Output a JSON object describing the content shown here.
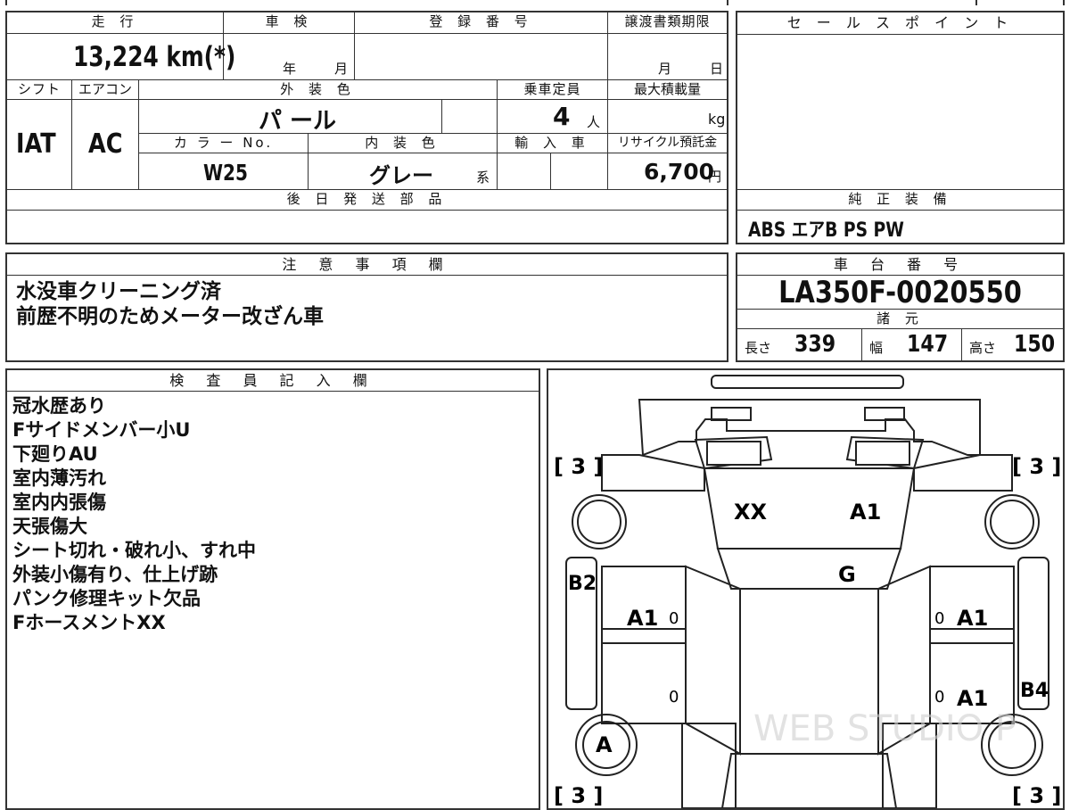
{
  "top_table": {
    "mileage_header": "走 行",
    "mileage": "13,224 km(*)",
    "shaken_header": "車 検",
    "shaken_year_unit": "年",
    "shaken_month_unit": "月",
    "registration_header": "登 録 番 号",
    "transfer_header": "譲渡書類期限",
    "transfer_month_unit": "月",
    "transfer_day_unit": "日",
    "shift_header": "シフト",
    "aircon_header": "エアコン",
    "exterior_header": "外 装 色",
    "capacity_header": "乗車定員",
    "maxload_header": "最大積載量",
    "shift": "IAT",
    "aircon": "AC",
    "exterior_color": "パ ール",
    "capacity": "4",
    "capacity_unit": "人",
    "maxload_unit": "kg",
    "color_no_header": "カ ラ ー No.",
    "interior_header": "内 装 色",
    "import_header": "輸 入 車",
    "recycle_header": "リサイクル預託金",
    "color_no": "W25",
    "interior_color": "グレー",
    "interior_suffix": "系",
    "recycle_fee": "6,700",
    "recycle_unit": "円",
    "later_parts_header": "後 日 発 送 部 品"
  },
  "sales_point": {
    "header": "セ ー ル ス ポ イ ン ト"
  },
  "equipment": {
    "header": "純 正 装 備",
    "value": "ABS エアB PS PW"
  },
  "notes": {
    "header": "注 意 事 項 欄",
    "lines": [
      "水没車クリーニング済",
      "前歴不明のためメーター改ざん車"
    ]
  },
  "chassis": {
    "header": "車 台 番 号",
    "number": "LA350F-0020550",
    "specs_header": "諸 元",
    "length_label": "長さ",
    "length": "339",
    "width_label": "幅",
    "width": "147",
    "height_label": "高さ",
    "height": "150"
  },
  "inspector": {
    "header": "検 査 員 記 入 欄",
    "lines": [
      "冠水歴あり",
      "Fサイドメンバー小U",
      "下廻りAU",
      "室内薄汚れ",
      "室内内張傷",
      "天張傷大",
      "シート切れ・破れ小、すれ中",
      "外装小傷有り、仕上げ跡",
      "パンク修理キット欠品",
      "FホースメントXX"
    ]
  },
  "diagram": {
    "tire_marks": [
      "[ 3 ]",
      "[ 3 ]",
      "[ 3 ]",
      "[ 3 ]"
    ],
    "marks": {
      "windshield_left": "XX",
      "windshield_right": "A1",
      "roof": "G",
      "left_side": "B2",
      "front_door_left": "A1",
      "front_door_right": "A1",
      "rear_door_right": "A1",
      "right_side": "B4",
      "rear_tire_left": "A"
    },
    "zeros": [
      "0",
      "0",
      "0",
      "0"
    ],
    "watermark": "WEB STUDIO P"
  }
}
